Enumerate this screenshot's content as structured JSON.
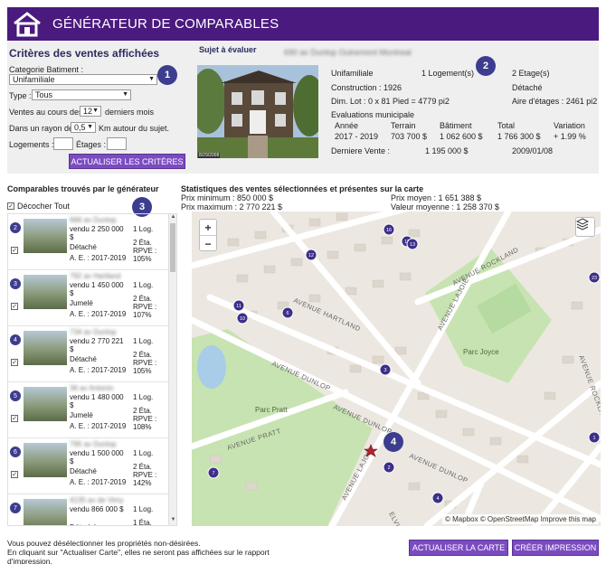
{
  "header": {
    "title": "GÉNÉRATEUR DE COMPARABLES",
    "logo_icon": "house-icon"
  },
  "criteria": {
    "title": "Critères des ventes affichées",
    "category_label": "Categorie Batiment :",
    "category_value": "Unifamiliale",
    "type_label": "Type :",
    "type_value": "Tous",
    "months_prefix": "Ventes au cours des",
    "months_value": "12",
    "months_suffix": "derniers mois",
    "radius_prefix": "Dans un rayon de",
    "radius_value": "0,5",
    "radius_suffix": "Km autour du sujet.",
    "logements_label": "Logements :",
    "etages_label": "Étages :",
    "update_button": "ACTUALISER LES CRITÈRES"
  },
  "subject": {
    "title": "Sujet à évaluer",
    "address": "690 av Dunlop Outremont Montreal",
    "category": "Unifamiliale",
    "logements": "1 Logement(s)",
    "etages": "2 Etage(s)",
    "construction": "Construction : 1926",
    "type": "Détaché",
    "lot": "Dim. Lot : 0 x 81 Pied = 4779 pi2",
    "floor_area": "Aire d'étages : 2461 pi2",
    "eval_title": "Evaluations municipale",
    "eval_headers": [
      "Année",
      "Terrain",
      "Bâtiment",
      "Total",
      "Variation"
    ],
    "eval_values": [
      "2017 - 2019",
      "703 700 $",
      "1 062 600 $",
      "1 766 300 $",
      "+ 1.99 %"
    ],
    "last_sale_label": "Derniere Vente :",
    "last_sale_price": "1 195 000 $",
    "last_sale_date": "2009/01/08",
    "photo_caption": "8/29/2008"
  },
  "badges": {
    "b1": "1",
    "b2": "2",
    "b3": "3",
    "b4": "4"
  },
  "comparables": {
    "title": "Comparables trouvés par le générateur",
    "uncheck_all": "Décocher Tout",
    "items": [
      {
        "num": "2",
        "addr": "666 av Dunlop",
        "sold": "vendu 2 250 000 $",
        "kind": "Détaché",
        "eval": "A. E. : 2017-2019",
        "logs": "1 Log.",
        "etas": "2 Éta.",
        "rpve": "RPVE : 105%"
      },
      {
        "num": "3",
        "addr": "792 av Hartland",
        "sold": "vendu 1 450 000 $",
        "kind": "Jumelé",
        "eval": "A. E. : 2017-2019",
        "logs": "1 Log.",
        "etas": "2 Éta.",
        "rpve": "RPVE : 107%"
      },
      {
        "num": "4",
        "addr": "734 av Dunlop",
        "sold": "vendu 2 770 221 $",
        "kind": "Détaché",
        "eval": "A. E. : 2017-2019",
        "logs": "1 Log.",
        "etas": "2 Éta.",
        "rpve": "RPVE : 105%"
      },
      {
        "num": "5",
        "addr": "36 av Antonin",
        "sold": "vendu 1 480 000 $",
        "kind": "Jumelé",
        "eval": "A. E. : 2017-2019",
        "logs": "1 Log.",
        "etas": "2 Éta.",
        "rpve": "RPVE : 108%"
      },
      {
        "num": "6",
        "addr": "795 av Dunlop",
        "sold": "vendu 1 500 000 $",
        "kind": "Détaché",
        "eval": "A. E. : 2017-2019",
        "logs": "1 Log.",
        "etas": "2 Éta.",
        "rpve": "RPVE : 142%"
      },
      {
        "num": "7",
        "addr": "4135 av de Vimy",
        "sold": "vendu 866 000 $",
        "kind": "Détaché",
        "eval": "",
        "logs": "1 Log.",
        "etas": "1 Éta.",
        "rpve": ""
      }
    ]
  },
  "stats": {
    "title": "Statistiques des ventes sélectionnées et présentes sur la carte",
    "min": "Prix minimum : 850 000 $",
    "max": "Prix maximum : 2 770 221 $",
    "avg": "Prix moyen : 1 651 388 $",
    "avg_value": "Valeur moyenne : 1 258 370 $"
  },
  "map": {
    "zoom_in": "+",
    "zoom_out": "−",
    "attribution": "© Mapbox © OpenStreetMap Improve this map",
    "streets": {
      "hartland": "AVENUE HARTLAND",
      "dunlop1": "AVENUE DUNLOP",
      "dunlop2": "AVENUE DUNLOP",
      "dunlop3": "AVENUE DUNLOP",
      "pratt": "AVENUE PRATT",
      "laidie1": "AVENUE LAJOIE",
      "laidie2": "AVENUE LAJOIE",
      "rockland": "AVENUE ROCKLAND",
      "rockland2": "AVENUE ROCKLAND",
      "kelvin": "ELVIN"
    },
    "parks": {
      "joyce": "Parc Joyce",
      "pratt": "Parc Pratt"
    },
    "markers": [
      "16",
      "11",
      "13",
      "12",
      "11",
      "10",
      "6",
      "3",
      "2",
      "4",
      "7",
      "23",
      "1"
    ]
  },
  "footer": {
    "line1": "Vous pouvez désélectionner les propriétés non-désirées.",
    "line2": "En cliquant sur \"Actualiser Carte\", elles ne seront pas affichées sur le rapport",
    "line3": "d'impression.",
    "update_map": "ACTUALISER LA CARTE",
    "print": "CRÉER IMPRESSION"
  }
}
